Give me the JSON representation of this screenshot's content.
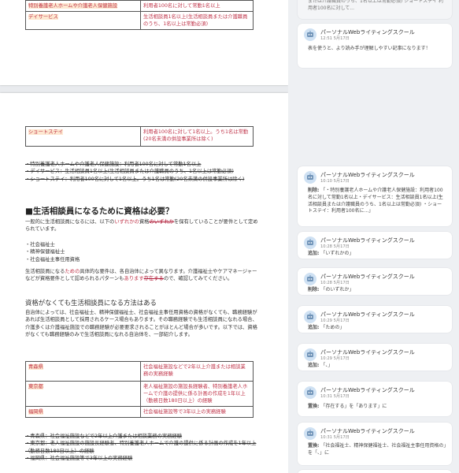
{
  "doc": {
    "top_table": [
      [
        "特別養護老人ホームや介護老人保健施設",
        "利用者100名に対して常勤1名以上"
      ],
      [
        "デイサービス",
        "生活相談員1名以上(生活相談員または介護職員のうち、1名以上は常勤必須)"
      ]
    ],
    "shortstay_table": [
      [
        "ショートステイ",
        "利用者100名に対して1名以上。うち1名は常勤(20名未満の併設事業所は除く)"
      ]
    ],
    "deleted_list_1": [
      "・特別養護老人ホームや介護老人保健施設：利用者100名に対して常勤1名以上",
      "・デイサービス：生活相談員1名以上(生活相談員または介護職員のうち、1名以上は常勤必須)",
      "・ショートステイ：利用者100名に対して1名以上。うち1名は常勤(20名未満の併設事業所は除く)"
    ],
    "heading_main": "■生活相談員になるために資格は必要？",
    "para1_a": "一般的に生活相談員になるには、以下の",
    "para1_ins": "いずれかの",
    "para1_b": "資格",
    "para1_del": "のいずれか",
    "para1_c": "を保有していることが要件として定められています。",
    "qualifications": [
      "・社会福祉士",
      "・精神保健福祉士",
      "・社会福祉主事任用資格"
    ],
    "para2_a": "生活相談員になる",
    "para2_ins1": "ための",
    "para2_b": "具体的な要件は、各自治体によって異なります。介護福祉士やケアマネージャーなどが資格要件として認められるパターンも",
    "para2_ins2": "あります",
    "para2_del": "存在する",
    "para2_c": "ので、確認してみてください。",
    "heading_sub": "資格がなくても生活相談員になる方法はある",
    "para3": "自治体によっては、社会福祉士、精神保健福祉士、社会福祉主事任用資格の資格がなくても、職務経験があれば生活相談員として採用されるケース場合もあります。その職務経験でも生活相談員になれる場合、介護多くは介護福祉施設での職務経験が必要要求されることがほとんど場合が多いです。以下では、資格がなくても職務経験のみで生活相談員になれる自治体を、一部紹介します。",
    "pref_table": [
      [
        "青森県",
        "社会福祉施設などで2年以上介護または相談業務の実務経験"
      ],
      [
        "東京都",
        "老人福祉施設の施設長経験者、特別養護老人ホームで介護の提供に係る計画の作成を1年以上（勤務日数180日以上）の経験"
      ],
      [
        "福岡県",
        "社会福祉施設等で3年以上の実務経験"
      ]
    ],
    "deleted_list_2": [
      "・青森県：社会福祉施設などで2年以上介護または相談業務の実務経験",
      "・東京都：老人福祉施設の施設長経験者、特別養護老人ホームで介護の提供に係る計画の作成を1年以上（勤務日数180日以上）の経験",
      "・福岡県：社会福祉施設等で3年以上の実務経験"
    ]
  },
  "comments": {
    "top_partial": "または介護職員のうち、1名以上は常勤必須) ショートステイ 利用者100名に対して...",
    "cards": [
      {
        "author": "パーソナルWebライティングスクール",
        "time": "12:51 5月17日",
        "label": "",
        "text": "表を使うと、より読み手が理解しやすい記事になります！"
      },
      {
        "author": "パーソナルWebライティングスクール",
        "time": "10:10 5月17日",
        "label": "削除:",
        "text": "「・特別養護老人ホームや介護老人保健施設：利用者100名に対して常勤1名以上・デイサービス：生活相談員1名以上(生活相談員または介護職員のうち、1名以上は常勤必須) ・ショートステイ：利用者100名に...」"
      },
      {
        "author": "パーソナルWebライティングスクール",
        "time": "10:28 5月17日",
        "label": "追加:",
        "text": "「いずれかの」"
      },
      {
        "author": "パーソナルWebライティングスクール",
        "time": "10:28 5月17日",
        "label": "削除:",
        "text": "「のいずれか」"
      },
      {
        "author": "パーソナルWebライティングスクール",
        "time": "10:29 5月17日",
        "label": "追加:",
        "text": "「ための」"
      },
      {
        "author": "パーソナルWebライティングスクール",
        "time": "10:29 5月17日",
        "label": "追加:",
        "text": "「、」"
      },
      {
        "author": "パーソナルWebライティングスクール",
        "time": "10:31 5月17日",
        "label": "置換:",
        "text": "「存在する」を「あります」に"
      },
      {
        "author": "パーソナルWebライティングスクール",
        "time": "10:31 5月17日",
        "label": "置換:",
        "text": "「社会福祉士、精神保健福祉士、社会福祉主事任用資格の」を「、」に"
      }
    ]
  },
  "colors": {
    "accent_red": "#c0354a",
    "highlight": "#fde7d0",
    "avatar": "#cfe1f3"
  }
}
